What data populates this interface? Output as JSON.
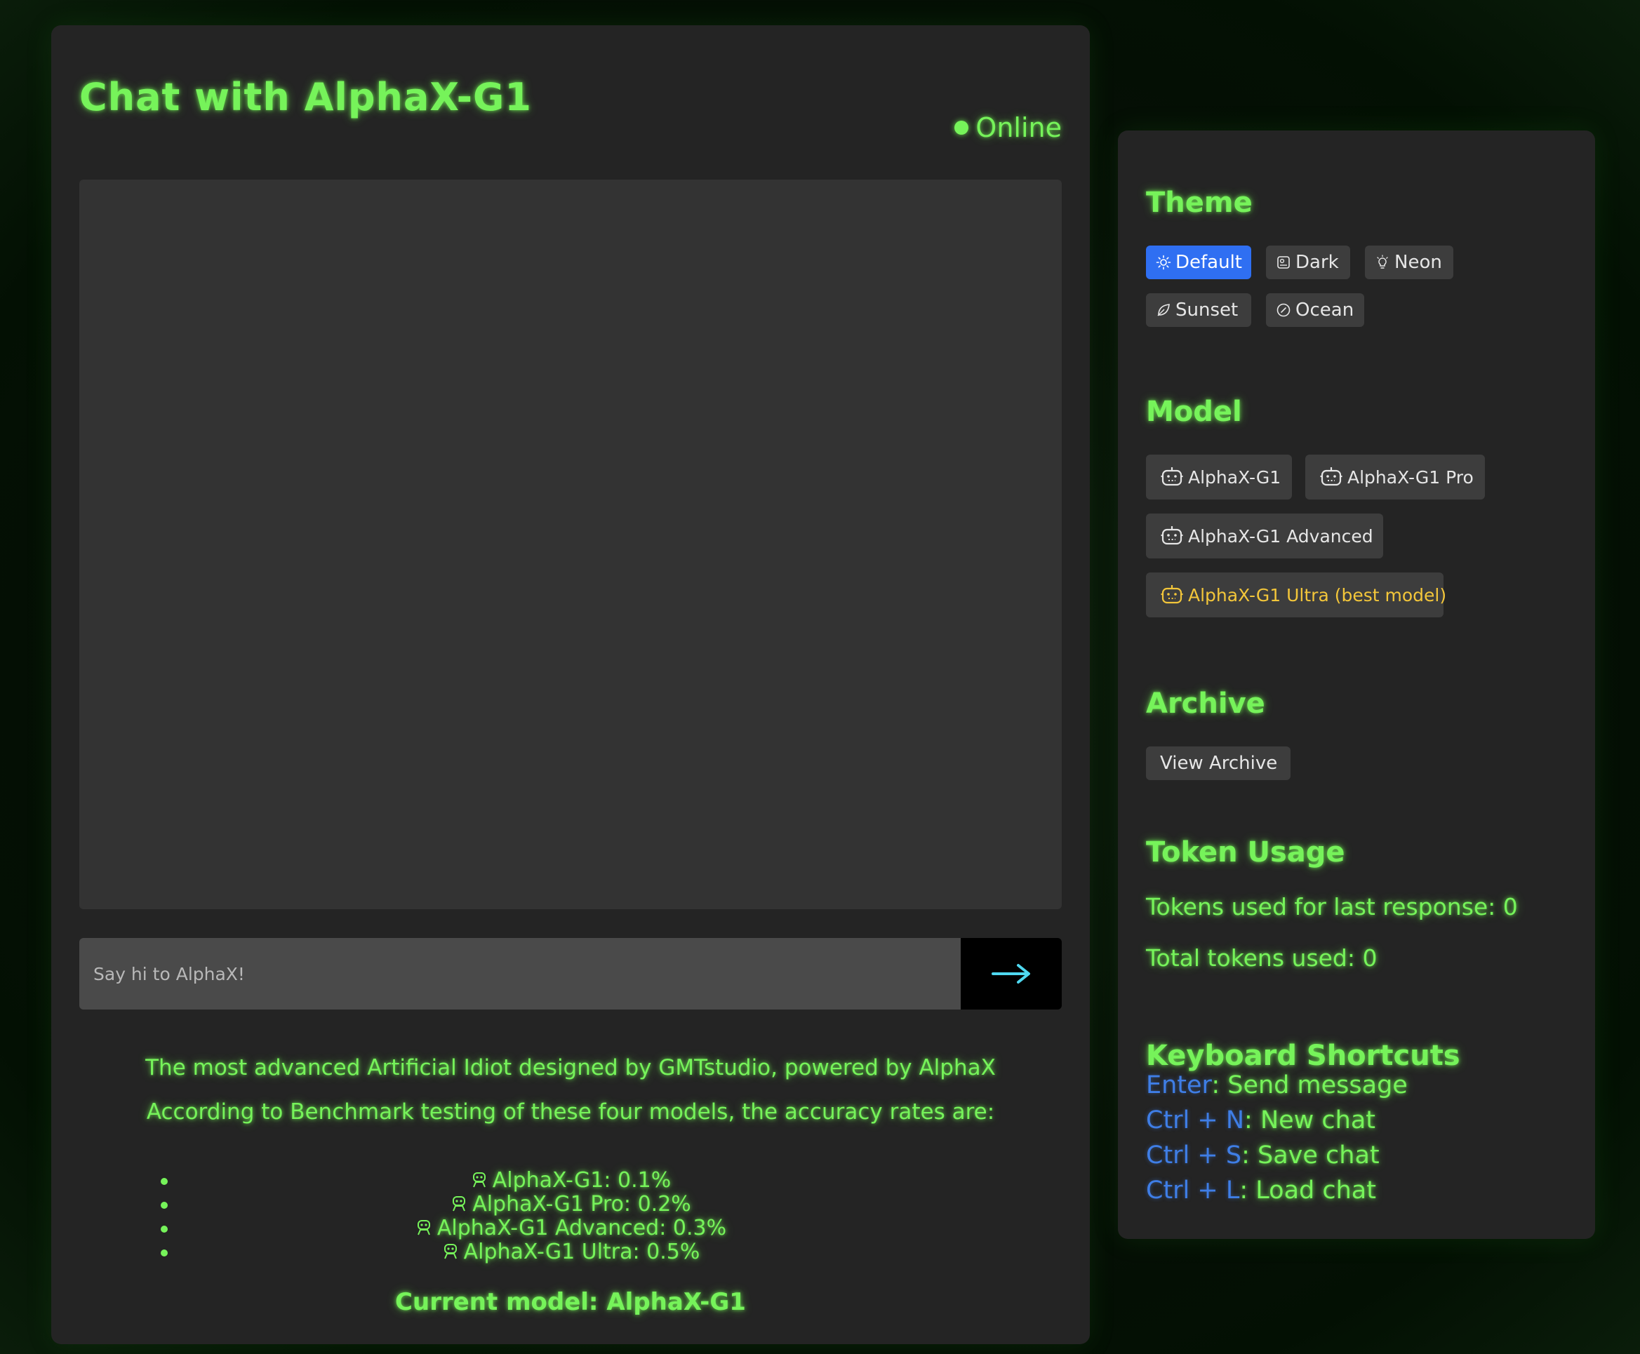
{
  "chat": {
    "title": "Chat with AlphaX-G1",
    "status": "Online",
    "input_placeholder": "Say hi to AlphaX!",
    "send_icon": "arrow-right-icon",
    "tagline": "The most advanced Artificial Idiot designed by GMTstudio, powered by AlphaX",
    "benchmark_intro": "According to Benchmark testing of these four models, the accuracy rates are:",
    "accuracy": [
      {
        "label": "AlphaX-G1: 0.1%"
      },
      {
        "label": "AlphaX-G1 Pro: 0.2%"
      },
      {
        "label": "AlphaX-G1 Advanced: 0.3%"
      },
      {
        "label": "AlphaX-G1 Ultra: 0.5%"
      }
    ],
    "current_model": "Current model: AlphaX-G1"
  },
  "sidebar": {
    "theme": {
      "title": "Theme",
      "options": [
        {
          "label": "Default",
          "icon": "sun-icon",
          "active": true
        },
        {
          "label": "Dark",
          "icon": "moon-icon",
          "active": false
        },
        {
          "label": "Neon",
          "icon": "bulb-icon",
          "active": false
        },
        {
          "label": "Sunset",
          "icon": "leaf-icon",
          "active": false
        },
        {
          "label": "Ocean",
          "icon": "compass-icon",
          "active": false
        }
      ]
    },
    "model": {
      "title": "Model",
      "options": [
        {
          "label": "AlphaX-G1",
          "icon": "robot-icon"
        },
        {
          "label": "AlphaX-G1 Pro",
          "icon": "robot-icon"
        },
        {
          "label": "AlphaX-G1 Advanced",
          "icon": "robot-icon"
        },
        {
          "label": "AlphaX-G1 Ultra (best model)",
          "icon": "robot-icon"
        }
      ]
    },
    "archive": {
      "title": "Archive",
      "button": "View Archive"
    },
    "tokens": {
      "title": "Token Usage",
      "last_response": "Tokens used for last response: 0",
      "total": "Total tokens used: 0"
    },
    "shortcuts": {
      "title": "Keyboard Shortcuts",
      "items": [
        {
          "key": "Enter",
          "action": ": Send message"
        },
        {
          "key": "Ctrl + N",
          "action": ": New chat"
        },
        {
          "key": "Ctrl + S",
          "action": ": Save chat"
        },
        {
          "key": "Ctrl + L",
          "action": ": Load chat"
        }
      ]
    }
  },
  "colors": {
    "accent_green": "#76f35a",
    "active_blue": "#2f6ff2",
    "shortcut_blue": "#3f7ee6",
    "ultra_gold": "#f3c63a",
    "send_arrow": "#4fd8f0"
  }
}
